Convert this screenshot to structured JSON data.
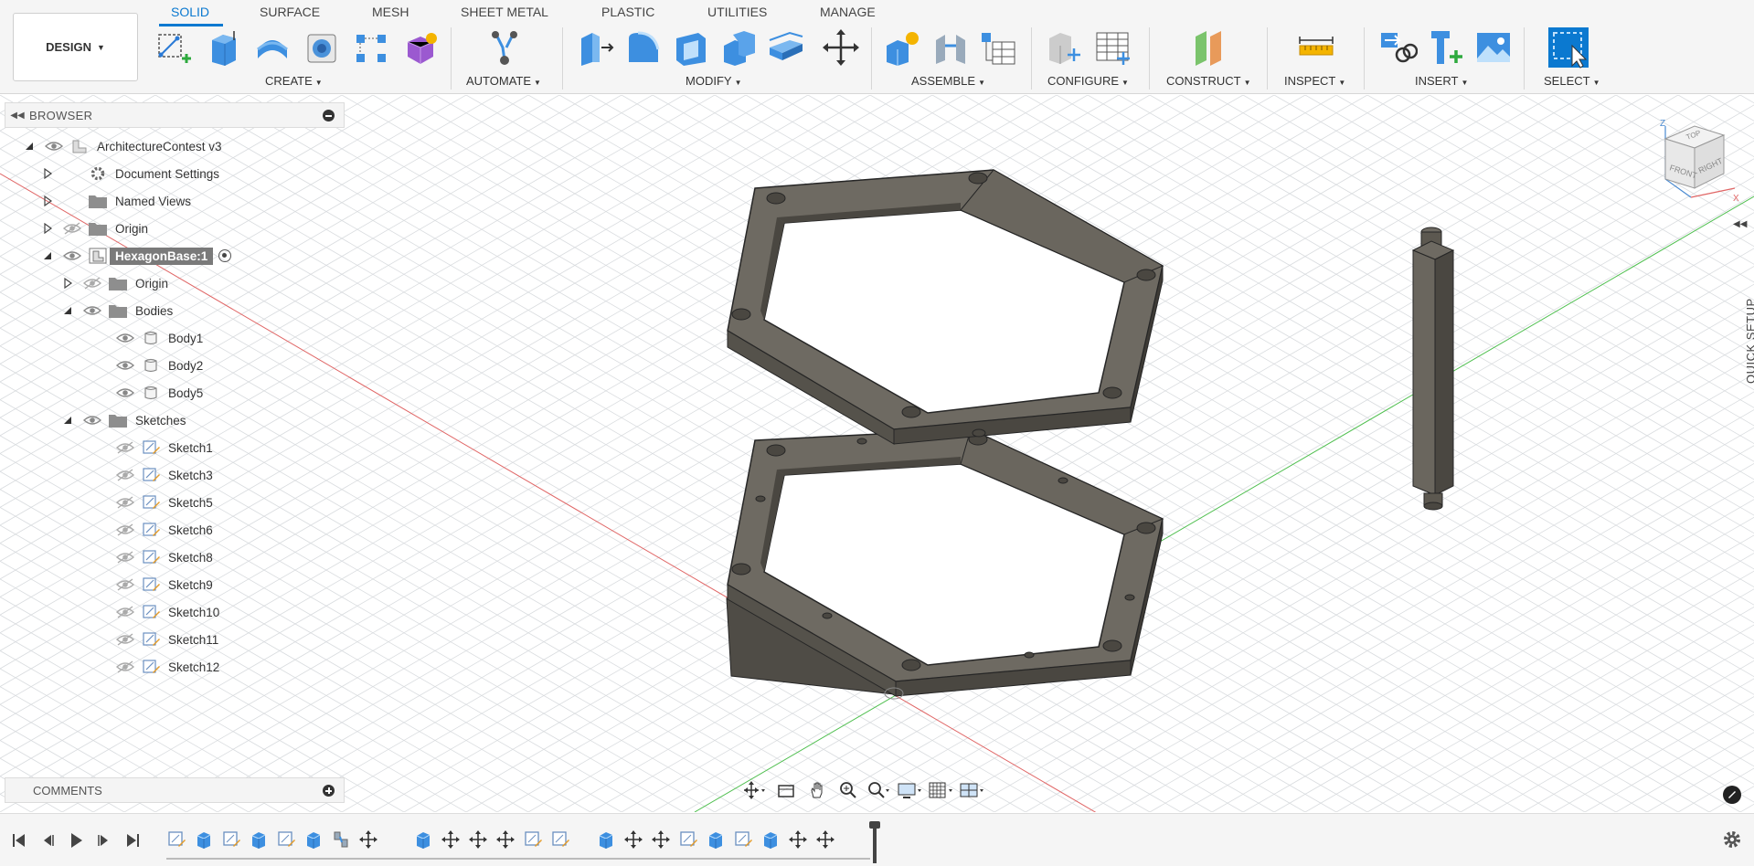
{
  "workspace": {
    "label": "DESIGN"
  },
  "tabs": [
    {
      "label": "SOLID",
      "active": true
    },
    {
      "label": "SURFACE"
    },
    {
      "label": "MESH"
    },
    {
      "label": "SHEET METAL"
    },
    {
      "label": "PLASTIC"
    },
    {
      "label": "UTILITIES"
    },
    {
      "label": "MANAGE"
    }
  ],
  "groups": {
    "create": "CREATE",
    "automate": "AUTOMATE",
    "modify": "MODIFY",
    "assemble": "ASSEMBLE",
    "configure": "CONFIGURE",
    "construct": "CONSTRUCT",
    "inspect": "INSPECT",
    "insert": "INSERT",
    "select": "SELECT"
  },
  "browser": {
    "title": "BROWSER",
    "root": "ArchitectureContest v3",
    "items": {
      "document_settings": "Document Settings",
      "named_views": "Named Views",
      "origin": "Origin",
      "component": "HexagonBase:1",
      "component_origin": "Origin",
      "bodies": "Bodies",
      "body1": "Body1",
      "body2": "Body2",
      "body5": "Body5",
      "sketches": "Sketches"
    },
    "sketches": [
      "Sketch1",
      "Sketch3",
      "Sketch5",
      "Sketch6",
      "Sketch8",
      "Sketch9",
      "Sketch10",
      "Sketch11",
      "Sketch12"
    ]
  },
  "comments": {
    "label": "COMMENTS"
  },
  "quick_setup": {
    "label": "QUICK SETUP"
  },
  "viewcube": {
    "top": "TOP",
    "front": "FRONT",
    "right": "RIGHT",
    "axis_z": "Z",
    "axis_x": "X"
  },
  "colors": {
    "accent": "#0b79d0",
    "model_face": "#6e6a62",
    "model_top": "#5f5b53",
    "model_edge": "#262626",
    "grid": "#d9dcdf",
    "axis_red": "#e06666",
    "axis_green": "#4fbf4f"
  },
  "timeline": {
    "features": [
      "sketch",
      "extrude",
      "sketch",
      "extrude",
      "sketch",
      "extrude",
      "joint",
      "move",
      "extrude",
      "move",
      "move",
      "move",
      "sketch",
      "sketch",
      "extrude",
      "move",
      "move",
      "sketch",
      "extrude",
      "sketch",
      "extrude",
      "move",
      "move"
    ]
  }
}
